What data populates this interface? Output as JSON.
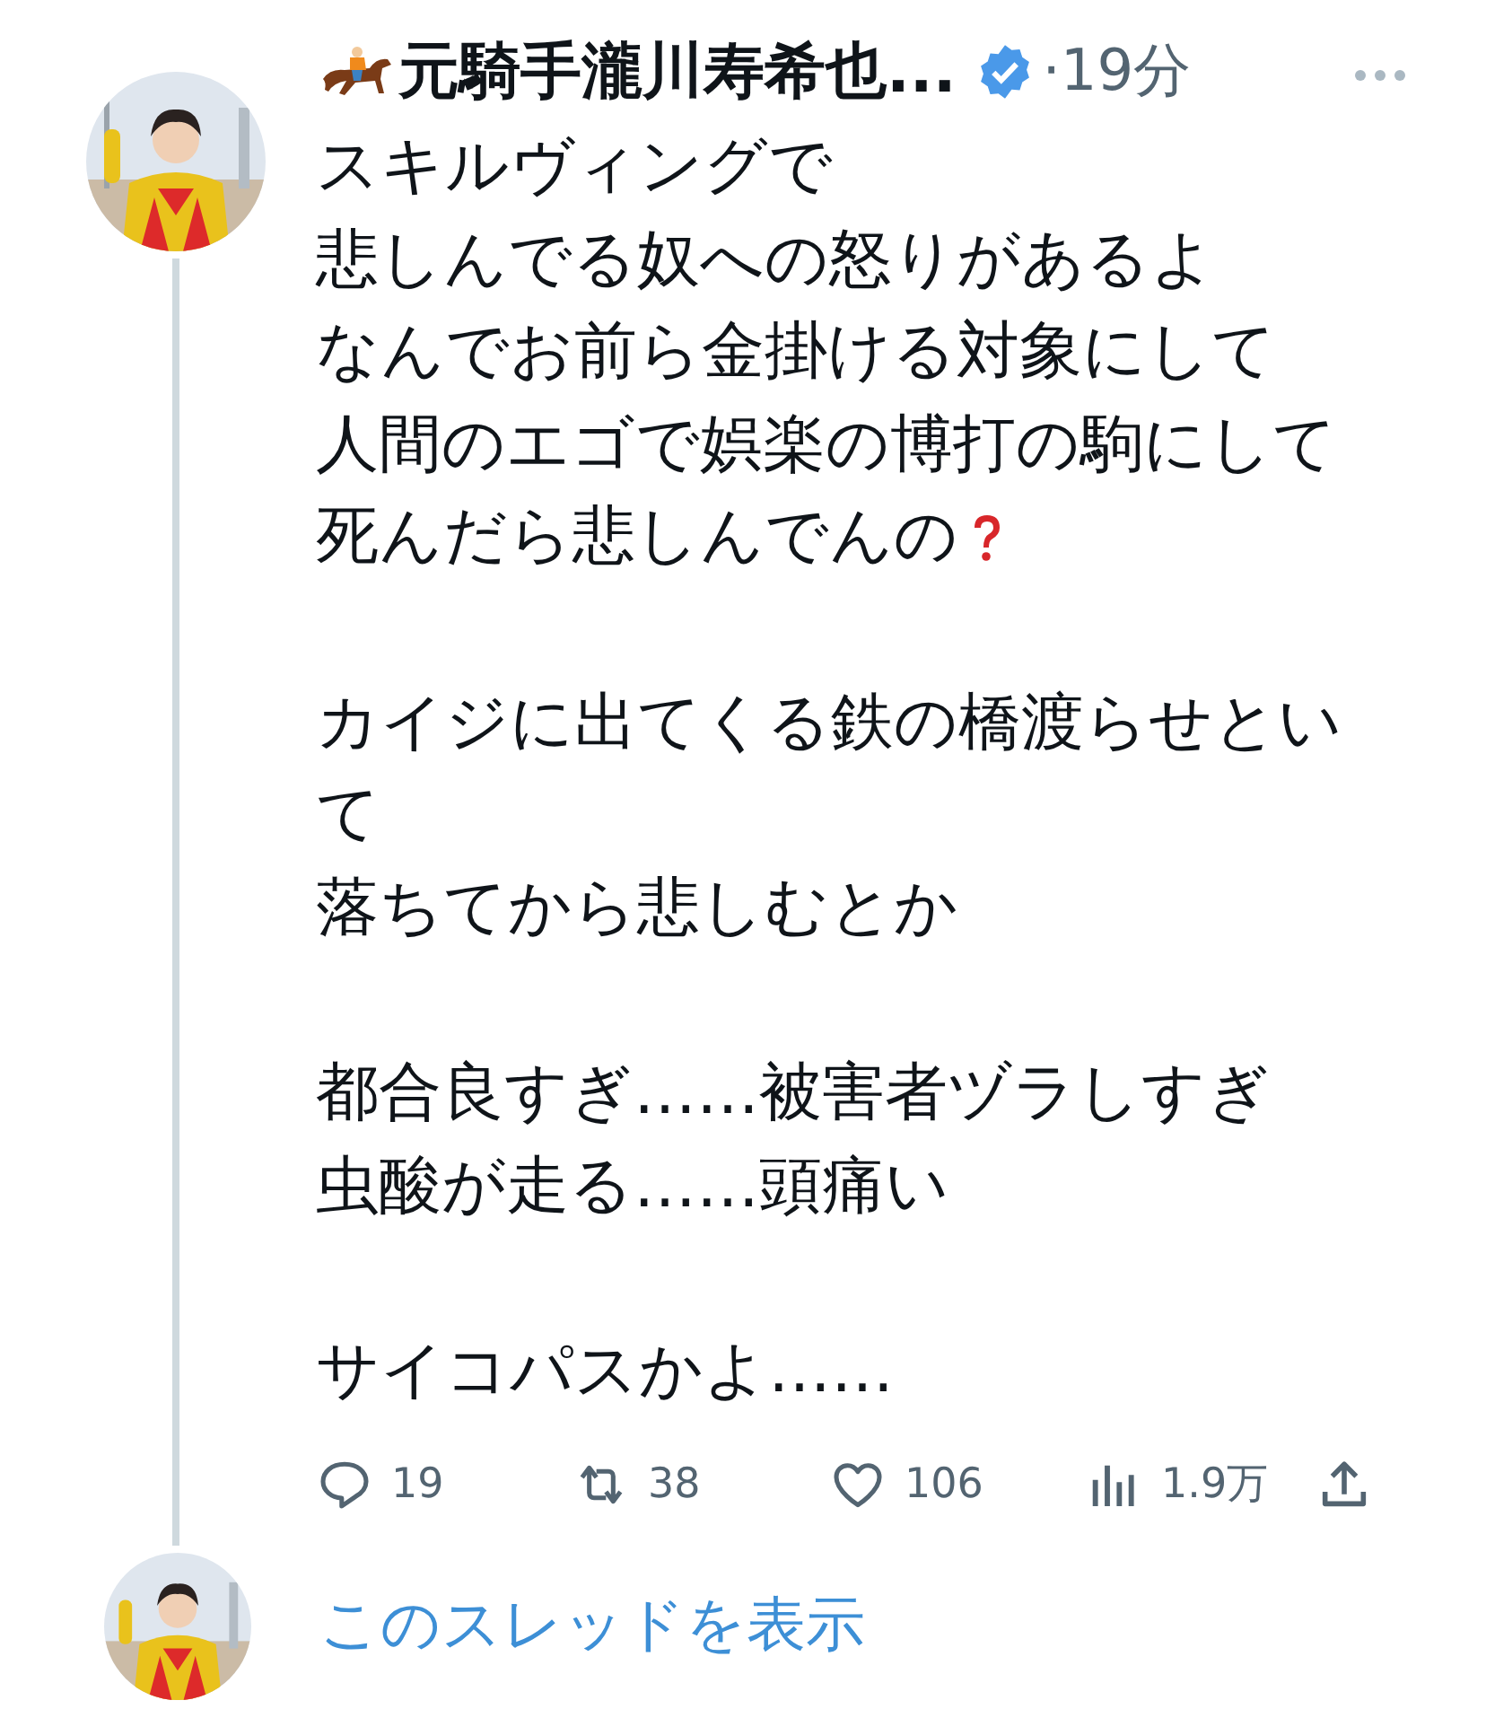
{
  "tweet": {
    "author": {
      "name": "元騎手瀧川寿希也...",
      "verified": true
    },
    "time": "·19分",
    "paragraphs": [
      {
        "lines": [
          "スキルヴィングで",
          "悲しんでる奴への怒りがあるよ",
          "なんでお前ら金掛ける対象にして",
          "人間のエゴで娯楽の博打の駒にして",
          "死んだら悲しんでんの"
        ],
        "question_mark": true
      },
      {
        "lines": [
          "カイジに出てくる鉄の橋渡らせとい",
          "て",
          "落ちてから悲しむとか"
        ]
      },
      {
        "lines": [
          "都合良すぎ……被害者ヅラしすぎ",
          "虫酸が走る……頭痛い"
        ]
      },
      {
        "lines": [
          "サイコパスかよ……"
        ]
      }
    ],
    "actions": [
      {
        "kind": "reply",
        "count": "19"
      },
      {
        "kind": "retweet",
        "count": "38"
      },
      {
        "kind": "like",
        "count": "106"
      },
      {
        "kind": "views",
        "count": "1.9万"
      },
      {
        "kind": "share"
      }
    ]
  },
  "thread_link": {
    "label": "このスレッドを表示"
  }
}
